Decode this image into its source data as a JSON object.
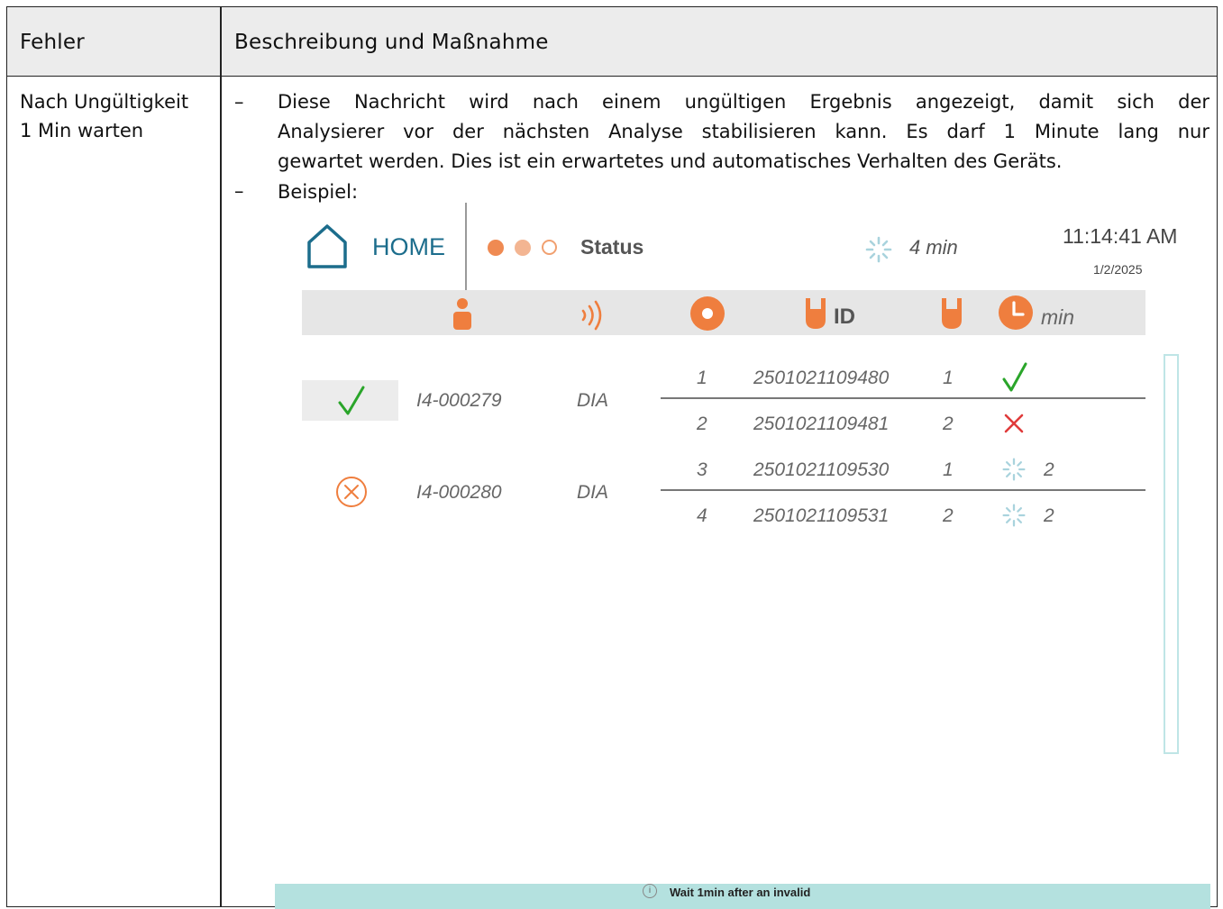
{
  "table": {
    "header": {
      "col_error": "Fehler",
      "col_description": "Beschreibung und Maßnahme"
    },
    "row": {
      "error_line1": "Nach Ungültigkeit",
      "error_line2": "1 Min warten",
      "bullet_marker": "–",
      "para_line1": "Diese Nachricht wird nach einem ungültigen Ergebnis angezeigt, damit sich der",
      "para_line2": "Analysierer vor der nächsten Analyse stabilisieren kann. Es darf 1 Minute lang nur",
      "para_line3": "gewartet werden. Dies ist ein erwartetes und automatisches Verhalten des Geräts.",
      "example_label": "Beispiel:"
    }
  },
  "device": {
    "home_label": "HOME",
    "status_label": "Status",
    "status_dots": [
      "#ef8a52",
      "#f3b592",
      "outline"
    ],
    "remaining_time": "4 min",
    "clock": "11:14:41 AM",
    "date": "1/2/2025",
    "column_headers": {
      "id": "ID",
      "min": "min"
    },
    "icons": [
      "home-icon",
      "patient-icon",
      "signal-icon",
      "disc-icon",
      "tube-icon",
      "clock-icon",
      "spinner-icon",
      "check-icon",
      "cross-icon",
      "circle-x-icon",
      "info-icon"
    ],
    "colors": {
      "accent": "#ef7e3e",
      "home_blue": "#1c6d8c",
      "ok_green": "#2aa52a",
      "error_red": "#e03b3b",
      "banner": "#b4e1df"
    },
    "samples": [
      {
        "status": "check",
        "patient": "I4-000279",
        "type": "DIA",
        "tests": [
          {
            "pos": "1",
            "id": "2501021109480",
            "n": "1",
            "result": "check",
            "count": ""
          },
          {
            "pos": "2",
            "id": "2501021109481",
            "n": "2",
            "result": "cross",
            "count": ""
          }
        ]
      },
      {
        "status": "circle-x",
        "patient": "I4-000280",
        "type": "DIA",
        "tests": [
          {
            "pos": "3",
            "id": "2501021109530",
            "n": "1",
            "result": "spinner",
            "count": "2"
          },
          {
            "pos": "4",
            "id": "2501021109531",
            "n": "2",
            "result": "spinner",
            "count": "2"
          }
        ]
      }
    ],
    "banner_text": "Wait 1min after an invalid"
  }
}
